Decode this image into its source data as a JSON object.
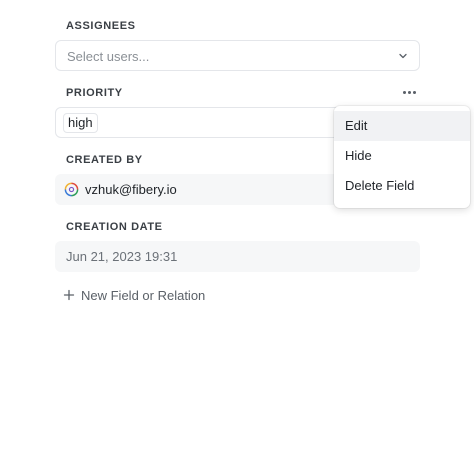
{
  "fields": {
    "assignees": {
      "label": "ASSIGNEES",
      "placeholder": "Select users..."
    },
    "priority": {
      "label": "PRIORITY",
      "value": "high"
    },
    "created_by": {
      "label": "CREATED BY",
      "value": "vzhuk@fibery.io"
    },
    "creation_date": {
      "label": "CREATION DATE",
      "value": "Jun 21, 2023 19:31"
    }
  },
  "new_field": {
    "label": "New Field or Relation"
  },
  "context_menu": {
    "items": [
      {
        "label": "Edit",
        "active": true
      },
      {
        "label": "Hide",
        "active": false
      },
      {
        "label": "Delete Field",
        "active": false
      }
    ]
  },
  "icons": {
    "chevron": "chevron-down-icon",
    "more": "more-horizontal-icon",
    "plus": "plus-icon",
    "avatar": "user-avatar-icon"
  }
}
